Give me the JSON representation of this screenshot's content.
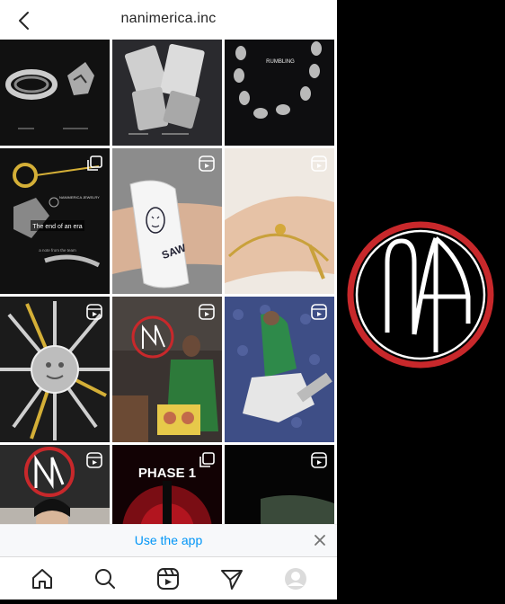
{
  "header": {
    "username": "nanimerica.inc"
  },
  "posts": [
    {
      "id": "post-1",
      "label": "Ring and skull jewelry",
      "type": "image"
    },
    {
      "id": "post-2",
      "label": "Card pendant",
      "type": "image"
    },
    {
      "id": "post-3",
      "label": "RUMBLING",
      "type": "image"
    },
    {
      "id": "post-4",
      "label": "The end of an era",
      "type": "multi"
    },
    {
      "id": "post-5",
      "label": "SAW bracelet",
      "type": "reel"
    },
    {
      "id": "post-6",
      "label": "Gold bracelet",
      "type": "reel"
    },
    {
      "id": "post-7",
      "label": "Pendant with blades",
      "type": "reel"
    },
    {
      "id": "post-8",
      "label": "Man in green apron",
      "type": "reel"
    },
    {
      "id": "post-9",
      "label": "Person lying down",
      "type": "reel"
    },
    {
      "id": "post-10",
      "label": "Woman with logo",
      "type": "reel"
    },
    {
      "id": "post-11",
      "label": "PHASE 1",
      "type": "multi"
    },
    {
      "id": "post-12",
      "label": "Wrist bracelet",
      "type": "reel"
    }
  ],
  "tile_text": {
    "rumbling": "RUMBLING",
    "end_era": "The end of an era",
    "end_era_sub": "a note from the team",
    "brand_small": "NANIMERICA JEWELRY",
    "phase": "PHASE 1"
  },
  "banner": {
    "text": "Use the app"
  },
  "tabs": [
    "home",
    "search",
    "reels",
    "direct",
    "profile"
  ],
  "colors": {
    "accent": "#0095f6",
    "logo_red": "#c8282b"
  }
}
